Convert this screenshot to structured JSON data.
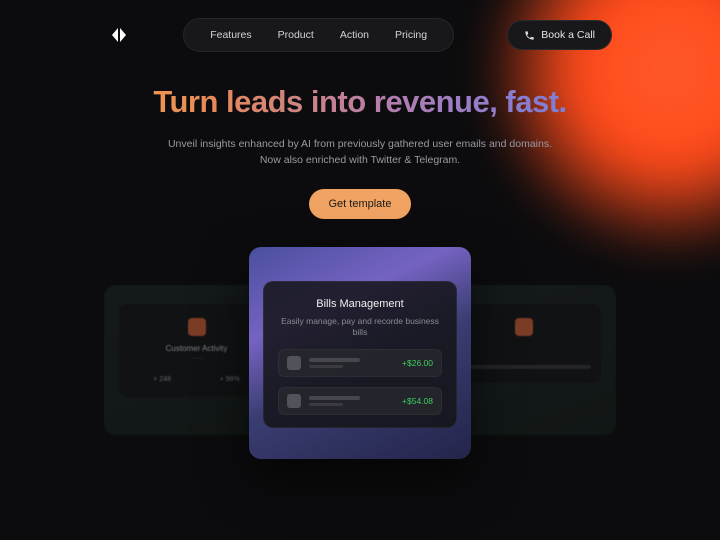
{
  "nav": {
    "items": [
      "Features",
      "Product",
      "Action",
      "Pricing"
    ],
    "cta": "Book a Call"
  },
  "hero": {
    "headline": "Turn leads into revenue, fast.",
    "sub1": "Unveil insights enhanced by AI from previously gathered user emails and domains.",
    "sub2": "Now also enriched with Twitter & Telegram.",
    "button": "Get template"
  },
  "card_left": {
    "title": "Customer Activity",
    "stat1": "+ 248",
    "stat2": "+ 98%"
  },
  "card_center": {
    "title": "Bills Management",
    "subtitle": "Easily manage, pay and recorde business bills",
    "bills": [
      {
        "amount": "+$26.00"
      },
      {
        "amount": "+$54.08"
      }
    ]
  },
  "colors": {
    "accent": "#f0a362",
    "positive": "#3fcf5e"
  }
}
